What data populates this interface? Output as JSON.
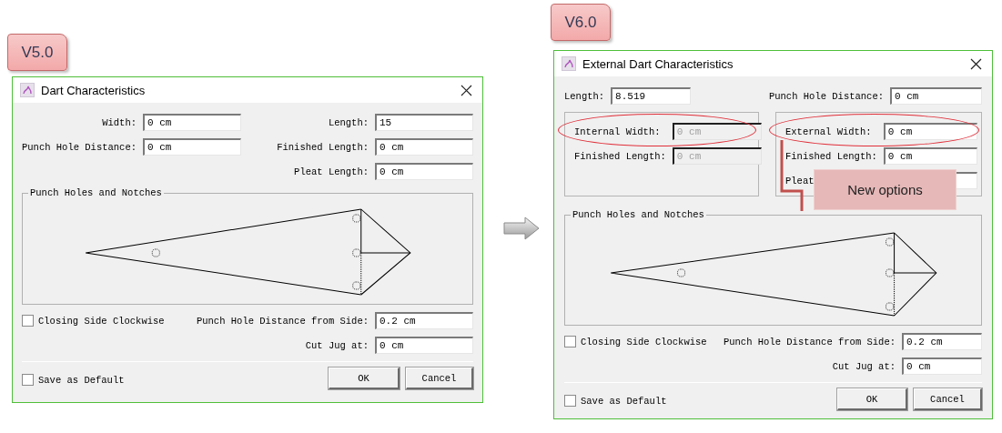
{
  "dialogs": [
    {
      "kind": "classic",
      "version_tag": "V5.0",
      "title": "Dart Characteristics",
      "top_left": [
        {
          "label": "Width:",
          "value": "0 cm"
        },
        {
          "label": "Punch Hole Distance:",
          "value": "0 cm"
        }
      ],
      "top_right": [
        {
          "label": "Length:",
          "value": "15"
        },
        {
          "label": "Finished Length:",
          "value": "0 cm"
        },
        {
          "label": "Pleat Length:",
          "value": "0 cm"
        }
      ],
      "group_title": "Punch Holes and Notches",
      "closing_side": {
        "label": "Closing Side Clockwise",
        "checked": false
      },
      "side_fields": [
        {
          "label": "Punch Hole Distance from Side:",
          "value": "0.2 cm"
        },
        {
          "label": "Cut Jug at:",
          "value": "0 cm"
        }
      ],
      "save_default": {
        "label": "Save as Default",
        "checked": false
      },
      "buttons": [
        "OK",
        "Cancel"
      ]
    },
    {
      "kind": "extended",
      "version_tag": "V6.0",
      "title": "External Dart Characteristics",
      "top_left": [
        {
          "label": "Length:",
          "value": "8.519"
        }
      ],
      "top_right": [
        {
          "label": "Punch Hole Distance:",
          "value": "0 cm"
        }
      ],
      "width_groups": [
        {
          "fields": [
            {
              "label": "Internal Width:",
              "value": "0 cm",
              "disabled": true,
              "circled": true
            },
            {
              "label": "Finished Length:",
              "value": "0 cm",
              "disabled": true,
              "circled": false
            }
          ]
        },
        {
          "callout": "New options",
          "fields": [
            {
              "label": "External Width:",
              "value": "0 cm",
              "disabled": false,
              "circled": true
            },
            {
              "label": "Finished Length:",
              "value": "0 cm",
              "disabled": false,
              "circled": false
            },
            {
              "label": "Pleat",
              "disabled": false,
              "circled": false
            }
          ]
        }
      ],
      "group_title": "Punch Holes and Notches",
      "closing_side": {
        "label": "Closing Side Clockwise",
        "checked": false
      },
      "side_fields": [
        {
          "label": "Punch Hole Distance from Side:",
          "value": "0.2 cm"
        },
        {
          "label": "Cut Jug at:",
          "value": "0 cm"
        }
      ],
      "save_default": {
        "label": "Save as Default",
        "checked": false
      },
      "buttons": [
        "OK",
        "Cancel"
      ]
    }
  ]
}
